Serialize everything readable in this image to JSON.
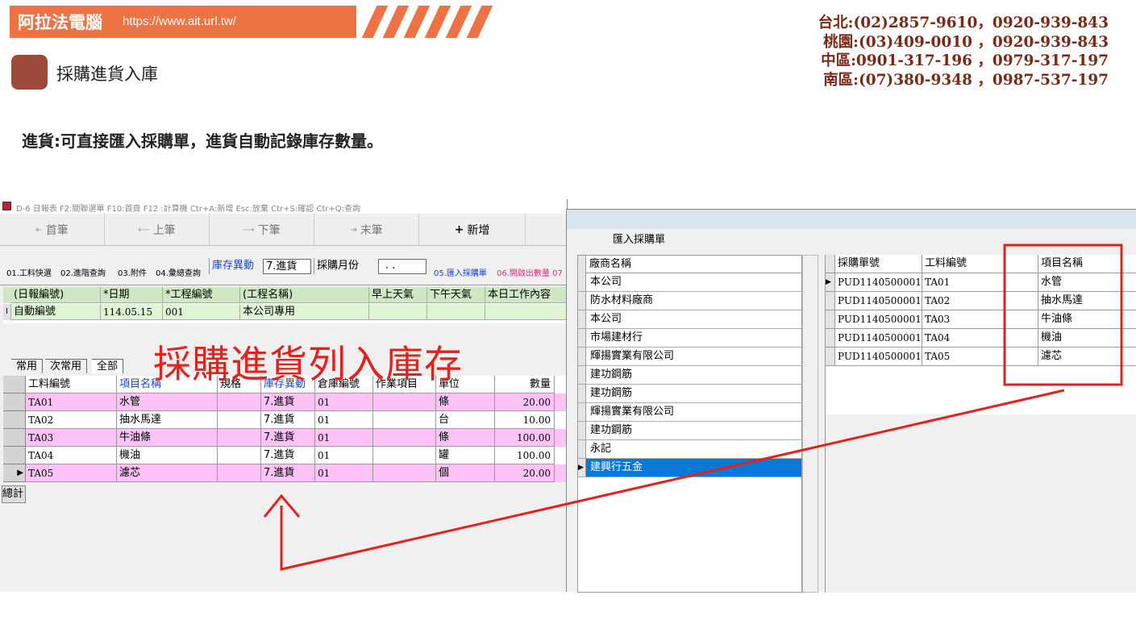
{
  "brand": {
    "name": "阿拉法電腦",
    "url": "https://www.ait.url.tw/"
  },
  "page": {
    "title": "採購進貨入庫",
    "description": "進貨:可直接匯入採購單，進貨自動記錄庫存數量。"
  },
  "contacts": [
    "台北:(02)2857-9610，0920-939-843",
    "桃園:(03)409-0010 ，0920-939-843",
    "中區:0901-317-196 ，0979-317-197",
    "南區:(07)380-9348 ，0987-537-197"
  ],
  "app": {
    "titlebar": "D-6 日報表    F2:關聯選單  F10:首頁  F12 :計算機   Ctr+A:新增   Esc:放棄   Ctr+S:確認   Ctr+Q:查詢",
    "nav": {
      "first": "首筆",
      "prev": "上筆",
      "next": "下筆",
      "last": "末筆",
      "add": "新增"
    },
    "toolbar": {
      "material_quick": "01.工料快選",
      "progress_query": "02.進階查詢",
      "attachment": "03.附件",
      "summary_query": "04.彙總查詢",
      "stock_change_label": "庫存異動",
      "stock_change_value": "7.進貨",
      "purchase_month_label": "採購月份",
      "purchase_month_value": ". .",
      "import_po": "05.匯入採購單",
      "open_qty": "06.開啟出數量 07"
    },
    "daily_grid": {
      "headers": [
        "(日報編號)",
        "*日期",
        "*工程編號",
        "(工程名稱)",
        "早上天氣",
        "下午天氣",
        "本日工作內容"
      ],
      "row_indicator": "I",
      "row": [
        "自動編號",
        "114.05.15",
        "001",
        "本公司專用",
        "",
        "",
        ""
      ]
    },
    "tabs": [
      "常用",
      "次常用",
      "全部"
    ],
    "items_grid": {
      "headers": [
        "工料編號",
        "項目名稱",
        "規格",
        "庫存異動",
        "倉庫編號",
        "作業項目",
        "單位",
        "數量"
      ],
      "rows": [
        [
          "TA01",
          "水管",
          "",
          "7.進貨",
          "01",
          "",
          "條",
          "20.00"
        ],
        [
          "TA02",
          "抽水馬達",
          "",
          "7.進貨",
          "01",
          "",
          "台",
          "10.00"
        ],
        [
          "TA03",
          "牛油條",
          "",
          "7.進貨",
          "01",
          "",
          "條",
          "100.00"
        ],
        [
          "TA04",
          "機油",
          "",
          "7.進貨",
          "01",
          "",
          "罐",
          "100.00"
        ],
        [
          "TA05",
          "濾芯",
          "",
          "7.進貨",
          "01",
          "",
          "個",
          "20.00"
        ]
      ],
      "total_label": "總計"
    }
  },
  "dialog": {
    "title": "匯入採購單",
    "vendor_header": "廠商名稱",
    "vendors": [
      "本公司",
      "防水材料廠商",
      "本公司",
      "市場建材行",
      "輝揚實業有限公司",
      "建功鋼筋",
      "建功鋼筋",
      "輝揚實業有限公司",
      "建功鋼筋",
      "永記",
      "建興行五金"
    ],
    "selected_vendor_index": 10,
    "po_headers": [
      "採購單號",
      "工料編號",
      "項目名稱"
    ],
    "po_rows": [
      [
        "PUD1140500001",
        "TA01",
        "水管"
      ],
      [
        "PUD1140500001",
        "TA02",
        "抽水馬達"
      ],
      [
        "PUD1140500001",
        "TA03",
        "牛油條"
      ],
      [
        "PUD1140500001",
        "TA04",
        "機油"
      ],
      [
        "PUD1140500001",
        "TA05",
        "濾芯"
      ]
    ]
  },
  "annotation": {
    "caption": "採購進貨列入庫存"
  },
  "colors": {
    "brand_orange": "#ee7344",
    "contact_text": "#7a2a16",
    "row_pink": "#fdc3f7",
    "header_green": "#cfe7c5",
    "selection_blue": "#0a78d7",
    "annotation_red": "#e8201b"
  }
}
